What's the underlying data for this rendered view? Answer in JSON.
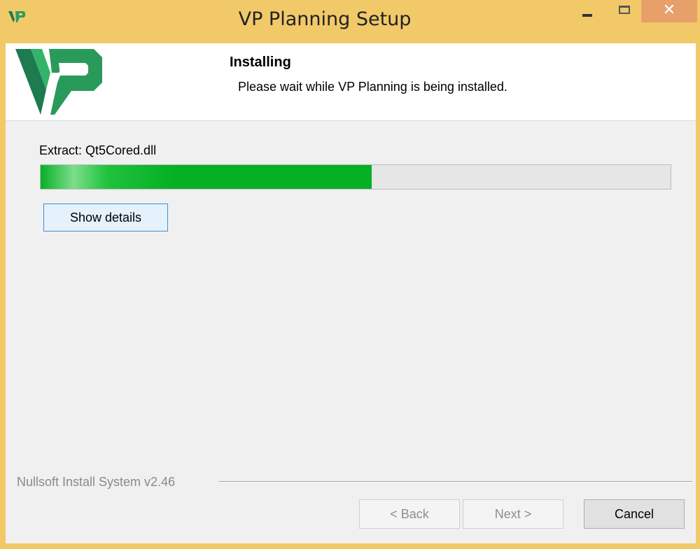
{
  "window": {
    "title": "VP Planning Setup",
    "close_glyph": "✕"
  },
  "header": {
    "title": "Installing",
    "subtitle": "Please wait while VP Planning  is being installed."
  },
  "progress": {
    "status_text": "Extract: Qt5Cored.dll",
    "fraction": 0.525
  },
  "buttons": {
    "show_details": "Show details",
    "back": "< Back",
    "next": "Next >",
    "cancel": "Cancel"
  },
  "footer": {
    "branding": "Nullsoft Install System v2.46"
  },
  "colors": {
    "titlebar": "#f2c969",
    "close_button": "#e8a06a",
    "progress_fill": "#06b025",
    "logo_dark": "#1e7a4f",
    "logo_light": "#34b36a"
  },
  "icons": {
    "app": "vp-logo-icon",
    "minimize": "minimize-icon",
    "maximize": "maximize-icon",
    "close": "close-icon"
  }
}
